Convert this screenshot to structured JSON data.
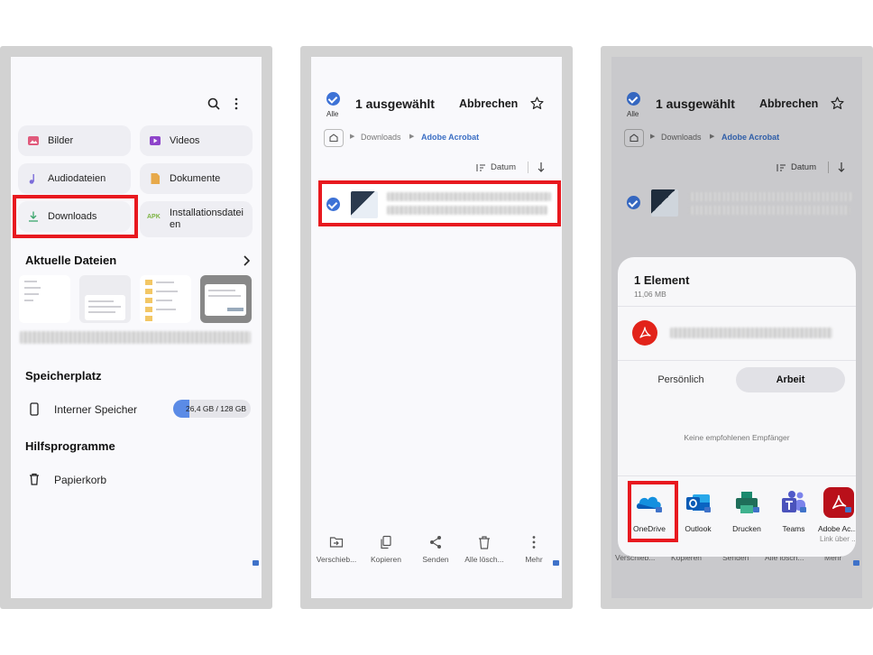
{
  "screen1": {
    "categories": [
      {
        "label": "Bilder",
        "icon": "image-icon",
        "color": "#e05a7c"
      },
      {
        "label": "Videos",
        "icon": "video-icon",
        "color": "#8e44ca"
      },
      {
        "label": "Audiodateien",
        "icon": "music-note-icon",
        "color": "#7b6cd9"
      },
      {
        "label": "Dokumente",
        "icon": "document-icon",
        "color": "#e7a94a"
      },
      {
        "label": "Downloads",
        "icon": "download-icon",
        "color": "#3aa56b"
      },
      {
        "label": "Installationsdateien",
        "icon": "apk-icon",
        "color": "#7cb342",
        "badge": "APK"
      }
    ],
    "recent_title": "Aktuelle Dateien",
    "storage_title": "Speicherplatz",
    "storage_item": "Interner Speicher",
    "storage_value": "26,4 GB / 128 GB",
    "storage_fraction": 0.21,
    "tools_title": "Hilfsprogramme",
    "trash_label": "Papierkorb"
  },
  "screen2": {
    "select_all": "Alle",
    "selected_title": "1 ausgewählt",
    "cancel": "Abbrechen",
    "breadcrumb": [
      "Downloads",
      "Adobe Acrobat"
    ],
    "sort_label": "Datum",
    "bottom_actions": [
      {
        "label": "Verschieb...",
        "icon": "move-icon"
      },
      {
        "label": "Kopieren",
        "icon": "copy-icon"
      },
      {
        "label": "Senden",
        "icon": "share-icon"
      },
      {
        "label": "Alle lösch...",
        "icon": "trash-icon"
      },
      {
        "label": "Mehr",
        "icon": "more-icon"
      }
    ]
  },
  "screen3": {
    "select_all": "Alle",
    "selected_title": "1 ausgewählt",
    "cancel": "Abbrechen",
    "breadcrumb": [
      "Downloads",
      "Adobe Acrobat"
    ],
    "sort_label": "Datum",
    "sheet_title": "1 Element",
    "sheet_size": "11,06 MB",
    "tab_personal": "Persönlich",
    "tab_work": "Arbeit",
    "no_recipients": "Keine empfohlenen Empfänger",
    "apps": [
      {
        "label": "OneDrive",
        "icon": "onedrive-icon",
        "color": "#0f6cbd"
      },
      {
        "label": "Outlook",
        "icon": "outlook-icon",
        "color": "#0a64c2"
      },
      {
        "label": "Drucken",
        "icon": "printer-icon",
        "color": "#1a8a6e"
      },
      {
        "label": "Teams",
        "icon": "teams-icon",
        "color": "#5059c9"
      },
      {
        "label": "Adobe Ac...",
        "icon": "adobe-acrobat-icon",
        "color": "#c4171e",
        "sub": "Link über ..."
      }
    ],
    "behind_actions": [
      "Verschieb...",
      "Kopieren",
      "Senden",
      "Alle lösch...",
      "Mehr"
    ]
  }
}
